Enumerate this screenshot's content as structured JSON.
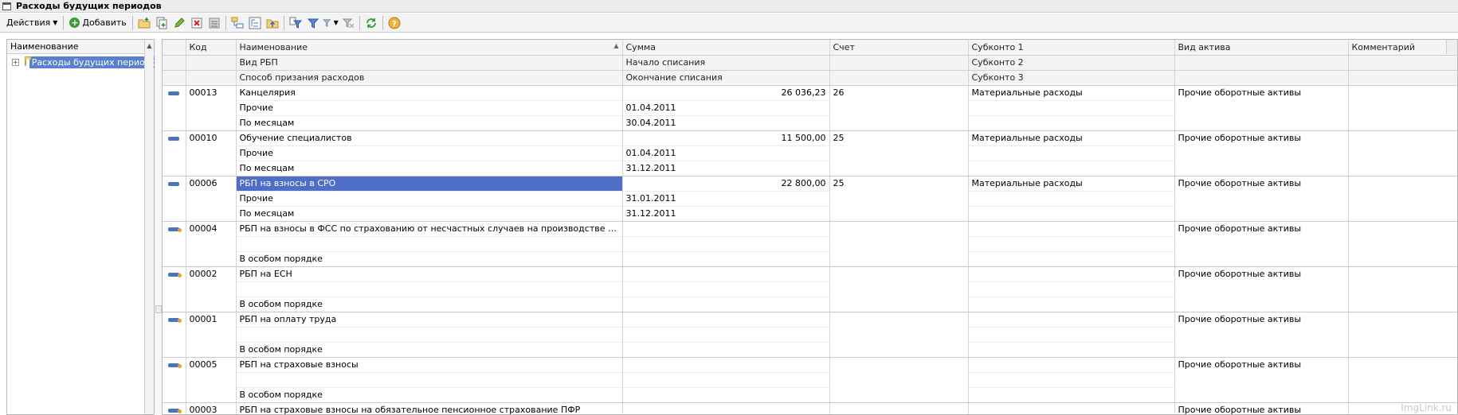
{
  "window": {
    "title": "Расходы будущих периодов"
  },
  "toolbar": {
    "actions_label": "Действия",
    "add_label": "Добавить"
  },
  "left_panel": {
    "header": "Наименование",
    "items": [
      {
        "label": "Расходы будущих периодов"
      }
    ]
  },
  "grid": {
    "headers": {
      "code": "Код",
      "name": "Наименование",
      "sum": "Сумма",
      "account": "Счет",
      "subkonto1": "Субконто 1",
      "asset_type": "Вид актива",
      "comment": "Комментарий",
      "rbp_type": "Вид РБП",
      "start": "Начало списания",
      "subkonto2": "Субконто 2",
      "method": "Способ призания расходов",
      "end": "Окончание списания",
      "subkonto3": "Субконто 3"
    },
    "rows": [
      {
        "code": "00013",
        "name": "Канцелярия",
        "sum": "26 036,23",
        "account": "26",
        "subkonto1": "Материальные расходы",
        "asset": "Прочие оборотные активы",
        "rbp_type": "Прочие",
        "start": "01.04.2011",
        "method": "По месяцам",
        "end": "30.04.2011"
      },
      {
        "code": "00010",
        "name": "Обучение специалистов",
        "sum": "11 500,00",
        "account": "25",
        "subkonto1": "Материальные расходы",
        "asset": "Прочие оборотные активы",
        "rbp_type": "Прочие",
        "start": "01.04.2011",
        "method": "По месяцам",
        "end": "31.12.2011"
      },
      {
        "code": "00006",
        "name": "РБП на взносы в СРО",
        "sum": "22 800,00",
        "account": "25",
        "subkonto1": "Материальные расходы",
        "asset": "Прочие оборотные активы",
        "rbp_type": "Прочие",
        "start": "31.01.2011",
        "method": "По месяцам",
        "end": "31.12.2011"
      },
      {
        "code": "00004",
        "name": "РБП на взносы в ФСС по страхованию от несчастных случаев на производстве и проф. ...",
        "sum": "",
        "account": "",
        "subkonto1": "",
        "asset": "Прочие оборотные активы",
        "rbp_type": "",
        "start": "",
        "method": "В особом порядке",
        "end": ""
      },
      {
        "code": "00002",
        "name": "РБП на ЕСН",
        "sum": "",
        "account": "",
        "subkonto1": "",
        "asset": "Прочие оборотные активы",
        "rbp_type": "",
        "start": "",
        "method": "В особом порядке",
        "end": ""
      },
      {
        "code": "00001",
        "name": "РБП на оплату труда",
        "sum": "",
        "account": "",
        "subkonto1": "",
        "asset": "Прочие оборотные активы",
        "rbp_type": "",
        "start": "",
        "method": "В особом порядке",
        "end": ""
      },
      {
        "code": "00005",
        "name": "РБП на страховые взносы",
        "sum": "",
        "account": "",
        "subkonto1": "",
        "asset": "Прочие оборотные активы",
        "rbp_type": "",
        "start": "",
        "method": "В особом порядке",
        "end": ""
      },
      {
        "code": "00003",
        "name": "РБП на страховые взносы на обязательное пенсионное страхование ПФР",
        "sum": "",
        "account": "",
        "subkonto1": "",
        "asset": "Прочие оборотные активы",
        "rbp_type": "",
        "start": "",
        "method": "",
        "end": ""
      }
    ]
  },
  "watermark": "ImgLink.ru",
  "colors": {
    "selection": "#4f6ec7",
    "header_bg": "#f4f4f4",
    "row_icon": "#4a74bd"
  }
}
